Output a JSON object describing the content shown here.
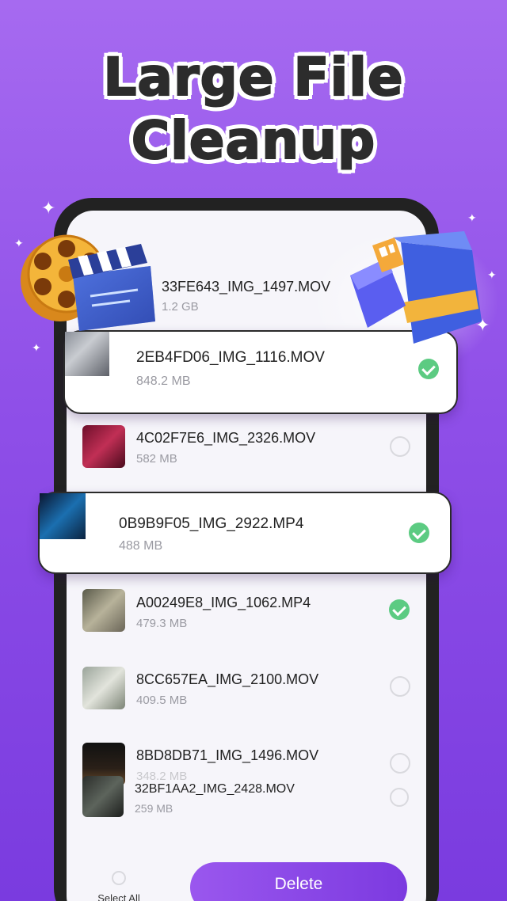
{
  "headline": {
    "line1": "Large File",
    "line2": "Cleanup"
  },
  "files": [
    {
      "name": "33FE643_IMG_1497.MOV",
      "size": "1.2 GB",
      "checked": false
    },
    {
      "name": "2EB4FD06_IMG_1116.MOV",
      "size": "848.2 MB",
      "checked": true
    },
    {
      "name": "4C02F7E6_IMG_2326.MOV",
      "size": "582 MB",
      "checked": false
    },
    {
      "name": "0B9B9F05_IMG_2922.MP4",
      "size": "488 MB",
      "checked": true
    },
    {
      "name": "A00249E8_IMG_1062.MP4",
      "size": "479.3 MB",
      "checked": true
    },
    {
      "name": "8CC657EA_IMG_2100.MOV",
      "size": "409.5 MB",
      "checked": false
    },
    {
      "name": "8BD8DB71_IMG_1496.MOV",
      "size": "348.2 MB",
      "checked": false
    },
    {
      "name": "32BF1AA2_IMG_2428.MOV",
      "size": "259 MB",
      "checked": false
    }
  ],
  "footer": {
    "select_all_label": "Select All",
    "delete_label": "Delete"
  },
  "colors": {
    "accent": "#8b4be8",
    "check_green": "#5ccb82",
    "background": "#9a5cf0"
  }
}
